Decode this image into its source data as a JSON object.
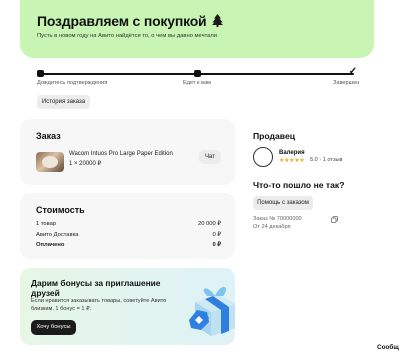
{
  "banner": {
    "title": "Поздравляем с покупкой",
    "title_icon": "christmas-tree-icon",
    "subtitle": "Пусть в новом году на Авито найдётся то, о чем вы давно мечтали",
    "color": "#c8f5b3"
  },
  "progress": {
    "steps": [
      {
        "label": "Дождитесь подтверждения",
        "state": "done"
      },
      {
        "label": "Едет к вам",
        "state": "done"
      },
      {
        "label": "Завершен",
        "state": "current"
      }
    ],
    "completed_fraction": 1.0
  },
  "history_button": "История заказа",
  "order": {
    "heading": "Заказ",
    "product_name": "Wacom Intuos Pro Large Paper Edition",
    "product_price": "1 × 20000 ₽",
    "chat_label": "Чат"
  },
  "cost": {
    "heading": "Стоимость",
    "rows": [
      {
        "label": "1 товар",
        "value": "20 000 ₽"
      },
      {
        "label": "Авито Доставка",
        "value": "0 ₽"
      },
      {
        "label": "Оплачено",
        "value": "0 ₽"
      }
    ]
  },
  "promo": {
    "title": "Дарим бонусы за приглашение друзей",
    "text": "Если нравится заказывать товары, советуйте Авито близким. 1 бонус = 1 ₽.",
    "button": "Хочу бонусы"
  },
  "seller": {
    "heading": "Продавец",
    "name": "Валерия",
    "stars": "★★★★★",
    "rating": "5.0 · 1 отзыв",
    "star_color": "#f5a623"
  },
  "problem": {
    "heading": "Что-то пошло не так?",
    "help_button": "Помощь с заказом"
  },
  "order_meta": {
    "number": "Заказ № 70000000",
    "date": "От 24 декабря"
  },
  "messages_label": "Сообщ"
}
